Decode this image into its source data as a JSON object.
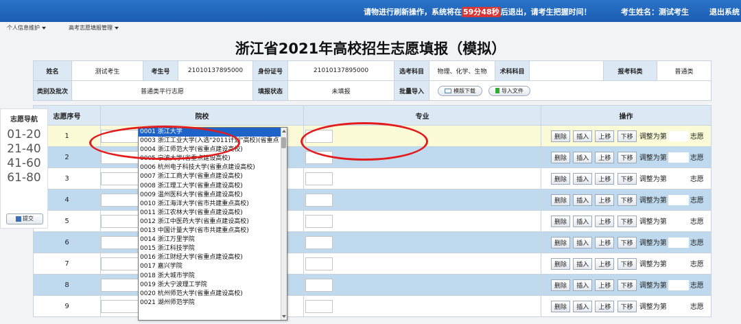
{
  "header": {
    "notice_before": "请物进行刷新操作，系统将在",
    "countdown": "59分48秒",
    "notice_after": "后退出，请考生把握时间！",
    "student_label": "考生姓名：",
    "student_name": "测试考生",
    "logout": "退出系统"
  },
  "menu": {
    "item1": "个人信息维护",
    "item2": "高考志愿填报管理"
  },
  "title": "浙江省2021年高校招生志愿填报（模拟）",
  "info": {
    "name_label": "姓名",
    "name_value": "测试考生",
    "exam_no_label": "考生号",
    "exam_no_value": "21010137895000",
    "id_label": "身份证号",
    "id_value": "21010137895000",
    "subjects_label": "选考科目",
    "subjects_value": "物理、化学、生物",
    "art_label": "术科科目",
    "art_value": "",
    "category_label": "报考科类",
    "category_value": "普通类",
    "batch_label": "类别及批次",
    "batch_value": "普通类平行志愿",
    "status_label": "填报状态",
    "status_value": "未填报",
    "import_label": "批量导入",
    "template_button": "模版下载",
    "import_button": "导入文件"
  },
  "side": {
    "title": "志愿导航",
    "ranges": [
      "01-20",
      "21-40",
      "41-60",
      "61-80"
    ],
    "submit": "提交"
  },
  "table": {
    "col_no": "志愿序号",
    "col_school": "院校",
    "col_major": "专业",
    "col_ops": "操作",
    "row_numbers": [
      "1",
      "2",
      "3",
      "4",
      "5",
      "6",
      "7",
      "8",
      "9"
    ],
    "op_delete": "删除",
    "op_insert": "插入",
    "op_up": "上移",
    "op_down": "下移",
    "op_adjust_pre": "调整为第",
    "op_adjust_post": "志愿"
  },
  "dropdown": {
    "options": [
      "0001 浙江大学",
      "0003 浙江工业大学(入选\"2011计划\"高校)(省重点",
      "0004 浙江师范大学(省重点建设高校)",
      "0005 宁波大学(省重点建设高校)",
      "0006 杭州电子科技大学(省重点建设高校)",
      "0007 浙江工商大学(省重点建设高校)",
      "0008 浙江理工大学(省重点建设高校)",
      "0009 温州医科大学(省重点建设高校)",
      "0010 浙江海洋大学(省市共建重点高校)",
      "0011 浙江农林大学(省重点建设高校)",
      "0012 浙江中医药大学(省重点建设高校)",
      "0013 中国计量大学(省市共建重点高校)",
      "0014 浙江万里学院",
      "0015 浙江科技学院",
      "0016 浙江财经大学(省重点建设高校)",
      "0017 嘉兴学院",
      "0018 浙大城市学院",
      "0019 浙大宁波理工学院",
      "0020 杭州师范大学(省重点建设高校)",
      "0021 湖州师范学院"
    ]
  },
  "colors": {
    "header_blue": "#1b5cb0",
    "row_yellow": "#fbfbd8",
    "row_blue": "#bfd9ef",
    "annotation_red": "#e31b1b",
    "select_blue": "#1e64c8"
  }
}
